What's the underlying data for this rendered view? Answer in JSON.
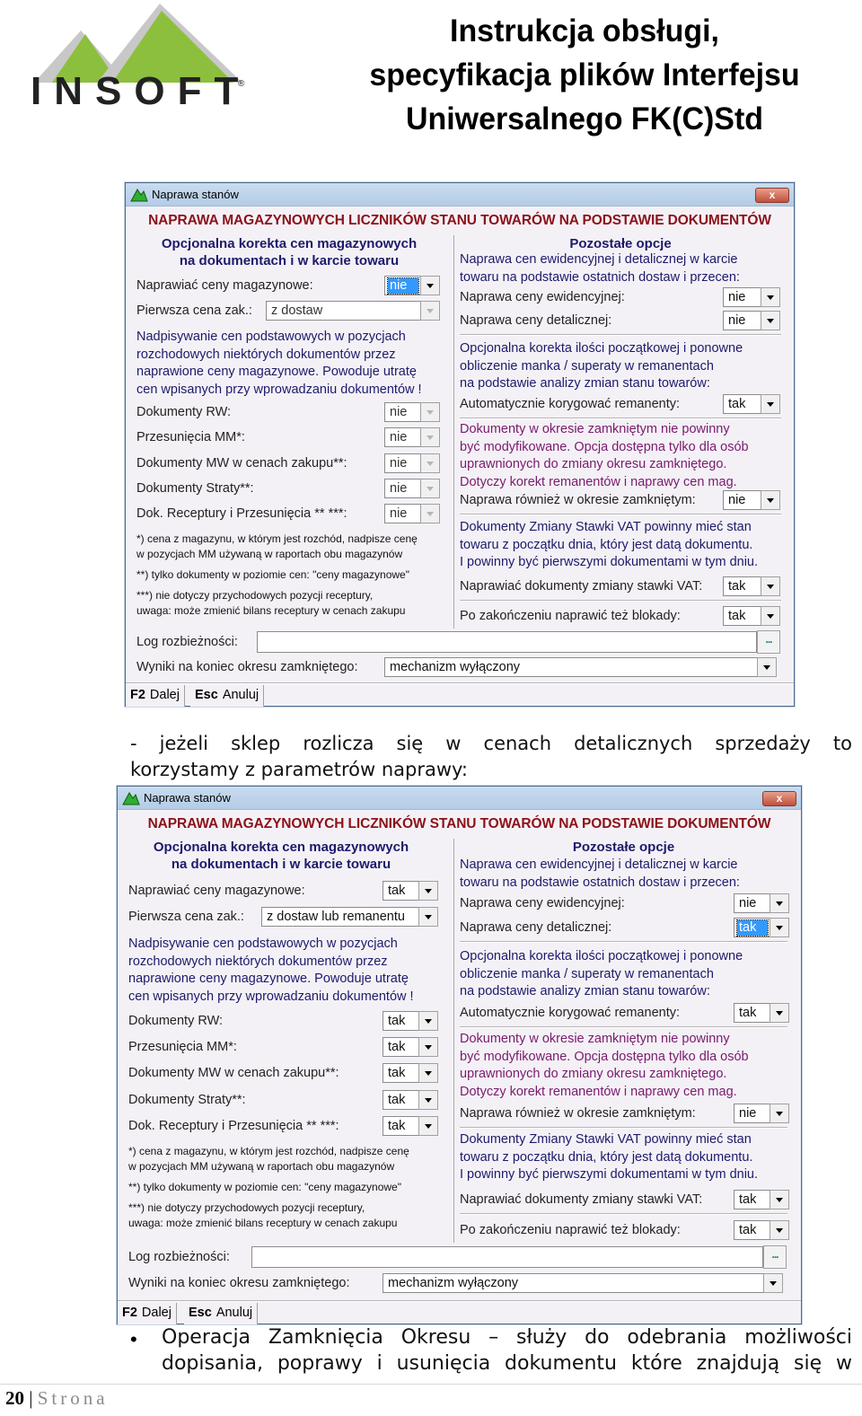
{
  "header": {
    "logo_text": "INSOFT",
    "logo_mark": "®",
    "title_lines": [
      "Instrukcja obsługi,",
      "specyfikacja plików Interfejsu",
      "Uniwersalnego FK(C)Std"
    ]
  },
  "colors": {
    "logo_green": "#8dbf3f",
    "logo_grey": "#c8c8c8",
    "dialog_headline": "#8b1219",
    "section_heading": "#1d1a6b",
    "warning_text": "#7a1a6e",
    "selection": "#3399ff"
  },
  "dialogs": [
    {
      "window_title": "Naprawa stanów",
      "close_label": "x",
      "headline": "NAPRAWA MAGAZYNOWYCH LICZNIKÓW STANU TOWARÓW NA PODSTAWIE DOKUMENTÓW",
      "left": {
        "heading": [
          "Opcjonalna korekta cen magazynowych",
          "na dokumentach i w karcie towaru"
        ],
        "naprawiac_label": "Naprawiać ceny magazynowe:",
        "naprawiac_value": "nie",
        "pierwsza_label": "Pierwsza cena zak.:",
        "pierwsza_value": "z dostaw",
        "overwrite_text": [
          "Nadpisywanie cen podstawowych w pozycjach",
          "rozchodowych niektórych dokumentów przez",
          "naprawione ceny magazynowe. Powoduje utratę",
          "cen wpisanych przy wprowadzaniu dokumentów !"
        ],
        "options": [
          {
            "label": "Dokumenty RW:",
            "value": "nie"
          },
          {
            "label": "Przesunięcia MM*:",
            "value": "nie"
          },
          {
            "label": "Dokumenty MW w cenach zakupu**:",
            "value": "nie"
          },
          {
            "label": "Dokumenty Straty**:",
            "value": "nie"
          },
          {
            "label": "Dok. Receptury i Przesunięcia ** ***:",
            "value": "nie"
          }
        ],
        "notes": [
          "*) cena z magazynu, w którym jest rozchód, nadpisze cenę",
          "w pozycjach MM używaną w raportach obu magazynów",
          "**) tylko dokumenty w poziomie cen: \"ceny magazynowe\"",
          "***) nie dotyczy przychodowych pozycji receptury,",
          "uwaga: może zmienić bilans receptury w cenach zakupu"
        ]
      },
      "right": {
        "heading": "Pozostałe opcje",
        "intro": [
          "Naprawa cen ewidencyjnej i detalicznej w karcie",
          "towaru na podstawie ostatnich dostaw i przecen:"
        ],
        "ewid_label": "Naprawa ceny ewidencyjnej:",
        "ewid_value": "nie",
        "detal_label": "Naprawa ceny detalicznej:",
        "detal_value": "nie",
        "korekta_text": [
          "Opcjonalna korekta ilości początkowej i ponowne",
          "obliczenie manka / superaty w remanentach",
          "na podstawie analizy zmian stanu towarów:"
        ],
        "auto_label": "Automatycznie korygować remanenty:",
        "auto_value": "tak",
        "closed_text": [
          "Dokumenty w okresie zamkniętym nie powinny",
          "być modyfikowane. Opcja dostępna tylko dla osób",
          "uprawnionych do zmiany okresu zamkniętego.",
          "Dotyczy korekt remanentów i naprawy cen mag."
        ],
        "closed_label": "Naprawa również w okresie zamkniętym:",
        "closed_value": "nie",
        "vat_text": [
          "Dokumenty Zmiany Stawki VAT powinny  mieć stan",
          "towaru z początku dnia, który jest datą dokumentu.",
          "I powinny być pierwszymi dokumentami w tym dniu."
        ],
        "vat_label": "Naprawiać dokumenty zmiany stawki VAT:",
        "vat_value": "tak",
        "blok_label": "Po zakończeniu naprawić też blokady:",
        "blok_value": "tak"
      },
      "log_label": "Log rozbieżności:",
      "log_value": "",
      "browse_label": "...",
      "wyniki_label": "Wyniki na koniec okresu zamkniętego:",
      "wyniki_value": "mechanizm wyłączony",
      "buttons": [
        {
          "key": "F2",
          "label": "Dalej"
        },
        {
          "key": "Esc",
          "label": "Anuluj"
        }
      ]
    },
    {
      "window_title": "Naprawa stanów",
      "close_label": "x",
      "headline": "NAPRAWA MAGAZYNOWYCH LICZNIKÓW STANU TOWARÓW NA PODSTAWIE DOKUMENTÓW",
      "left": {
        "heading": [
          "Opcjonalna korekta cen magazynowych",
          "na dokumentach i w karcie towaru"
        ],
        "naprawiac_label": "Naprawiać ceny magazynowe:",
        "naprawiac_value": "tak",
        "pierwsza_label": "Pierwsza cena zak.:",
        "pierwsza_value": "z dostaw lub remanentu",
        "overwrite_text": [
          "Nadpisywanie cen podstawowych w pozycjach",
          "rozchodowych niektórych dokumentów przez",
          "naprawione ceny magazynowe. Powoduje utratę",
          "cen wpisanych przy wprowadzaniu dokumentów !"
        ],
        "options": [
          {
            "label": "Dokumenty RW:",
            "value": "tak"
          },
          {
            "label": "Przesunięcia MM*:",
            "value": "tak"
          },
          {
            "label": "Dokumenty MW w cenach zakupu**:",
            "value": "tak"
          },
          {
            "label": "Dokumenty Straty**:",
            "value": "tak"
          },
          {
            "label": "Dok. Receptury i Przesunięcia ** ***:",
            "value": "tak"
          }
        ],
        "notes": [
          "*) cena z magazynu, w którym jest rozchód, nadpisze cenę",
          "w pozycjach MM używaną w raportach obu magazynów",
          "**) tylko dokumenty w poziomie cen: \"ceny magazynowe\"",
          "***) nie dotyczy przychodowych pozycji receptury,",
          "uwaga: może zmienić bilans receptury w cenach zakupu"
        ]
      },
      "right": {
        "heading": "Pozostałe opcje",
        "intro": [
          "Naprawa cen ewidencyjnej i detalicznej w karcie",
          "towaru na podstawie ostatnich dostaw i przecen:"
        ],
        "ewid_label": "Naprawa ceny ewidencyjnej:",
        "ewid_value": "nie",
        "detal_label": "Naprawa ceny detalicznej:",
        "detal_value": "tak",
        "korekta_text": [
          "Opcjonalna korekta ilości początkowej i ponowne",
          "obliczenie manka / superaty w remanentach",
          "na podstawie analizy zmian stanu towarów:"
        ],
        "auto_label": "Automatycznie korygować remanenty:",
        "auto_value": "tak",
        "closed_text": [
          "Dokumenty w okresie zamkniętym nie powinny",
          "być modyfikowane. Opcja dostępna tylko dla osób",
          "uprawnionych do zmiany okresu zamkniętego.",
          "Dotyczy korekt remanentów i naprawy cen mag."
        ],
        "closed_label": "Naprawa również w okresie zamkniętym:",
        "closed_value": "nie",
        "vat_text": [
          "Dokumenty Zmiany Stawki VAT powinny  mieć stan",
          "towaru z początku dnia, który jest datą dokumentu.",
          "I powinny być pierwszymi dokumentami w tym dniu."
        ],
        "vat_label": "Naprawiać dokumenty zmiany stawki VAT:",
        "vat_value": "tak",
        "blok_label": "Po zakończeniu naprawić też blokady:",
        "blok_value": "tak"
      },
      "log_label": "Log rozbieżności:",
      "log_value": "",
      "browse_label": "...",
      "wyniki_label": "Wyniki na koniec okresu zamkniętego:",
      "wyniki_value": "mechanizm wyłączony",
      "buttons": [
        {
          "key": "F2",
          "label": "Dalej"
        },
        {
          "key": "Esc",
          "label": "Anuluj"
        }
      ]
    }
  ],
  "body": {
    "retail_para": [
      "- jeżeli sklep rozlicza się w cenach detalicznych sprzedaży to",
      "korzystamy z parametrów naprawy:"
    ],
    "bullet_char": "•",
    "closing_para": [
      "Operacja Zamknięcia Okresu – służy do odebrania możliwości",
      "dopisania, poprawy i usunięcia dokumentu które znajdują się  w"
    ]
  },
  "footer": {
    "page_number": "20",
    "separator": "|",
    "page_label": "Strona"
  }
}
